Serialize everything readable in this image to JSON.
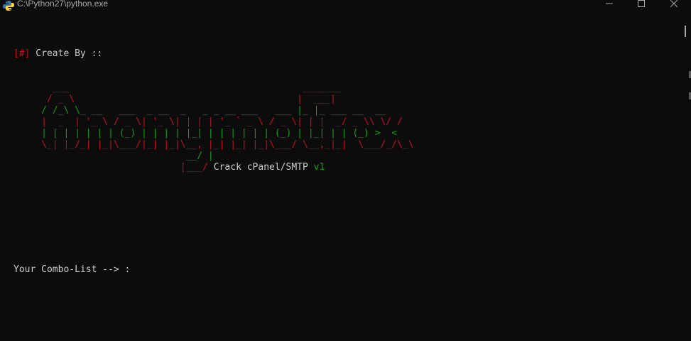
{
  "window": {
    "title": "C:\\Python27\\python.exe",
    "icon": "python-icon",
    "controls": [
      "minimize-icon",
      "maximize-icon",
      "close-icon"
    ]
  },
  "console": {
    "create_by_prefix": "[#]",
    "create_by_text": " Create By ::",
    "ascii_art": [
      {
        "segments": [
          {
            "t": "       ___                                          _______",
            "c": "red"
          }
        ]
      },
      {
        "segments": [
          {
            "t": "      / _ \\                                        |  ___|",
            "c": "red"
          }
        ]
      },
      {
        "segments": [
          {
            "t": "     / /_\\ \\_ __   ___  _ __  _   _ _ __ ___   ___ |_ |_ ___ __  __",
            "c": "green"
          }
        ]
      },
      {
        "segments": [
          {
            "t": "     |  _  | '_ \\ / _ \\| '_ \\| | | | '_ ` _ \\ / _ \\| | |  _/ _ \\\\ \\/ /",
            "c": "red"
          }
        ]
      },
      {
        "segments": [
          {
            "t": "     | | | | | | | (_) | | | | |_| | | | | | | (_) | |_| | | (_) >  <",
            "c": "green"
          }
        ]
      },
      {
        "segments": [
          {
            "t": "     \\_| |_/_| |_|\\___/|_| |_|\\__, |_| |_| |_|\\___/ \\__,_|_|  \\___/_/\\_\\",
            "c": "red"
          }
        ]
      },
      {
        "segments": [
          {
            "t": "                               __/ |",
            "c": "green"
          }
        ]
      },
      {
        "segments": [
          {
            "t": "                              |___/",
            "c": "red"
          },
          {
            "t": " Crack cPanel/SMTP ",
            "c": "white"
          },
          {
            "t": "v1",
            "c": "green"
          }
        ]
      }
    ],
    "prompt": "Your Combo-List --> :"
  },
  "colors": {
    "background": "#0c0c0c",
    "text": "#cccccc",
    "red": "#c50f1f",
    "green": "#13a10e"
  }
}
